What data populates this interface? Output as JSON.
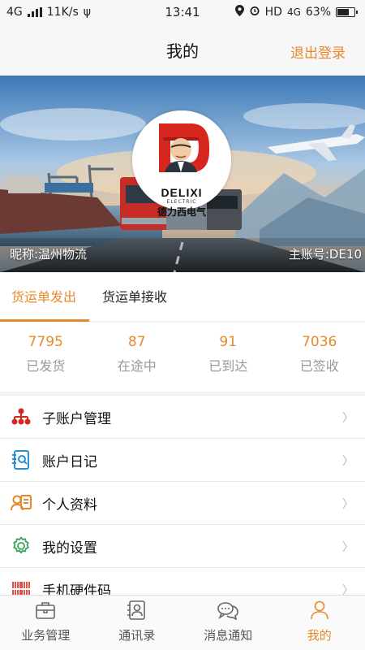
{
  "status_bar": {
    "network": "4G",
    "speed": "11K/s",
    "time": "13:41",
    "hd": "HD",
    "network2": "4G",
    "battery": "63%"
  },
  "header": {
    "title": "我的",
    "logout_label": "退出登录"
  },
  "banner": {
    "nickname": "昵称:温州物流",
    "account": "主账号:DE10",
    "logo_brand": "DELIXI",
    "logo_sub": "ELECTRIC",
    "logo_cn": "德力西电气"
  },
  "tabs": [
    {
      "label": "货运单发出",
      "active": true
    },
    {
      "label": "货运单接收",
      "active": false
    }
  ],
  "stats": [
    {
      "value": "7795",
      "label": "已发货"
    },
    {
      "value": "87",
      "label": "在途中"
    },
    {
      "value": "91",
      "label": "已到达"
    },
    {
      "value": "7036",
      "label": "已签收"
    }
  ],
  "menu": [
    {
      "label": "子账户管理",
      "icon": "org-chart-icon"
    },
    {
      "label": "账户日记",
      "icon": "journal-search-icon"
    },
    {
      "label": "个人资料",
      "icon": "profile-card-icon"
    },
    {
      "label": "我的设置",
      "icon": "gear-icon"
    },
    {
      "label": "手机硬件码",
      "icon": "barcode-icon"
    }
  ],
  "bottom_nav": [
    {
      "label": "业务管理",
      "icon": "briefcase-icon",
      "active": false
    },
    {
      "label": "通讯录",
      "icon": "contacts-icon",
      "active": false
    },
    {
      "label": "消息通知",
      "icon": "chat-bubbles-icon",
      "active": false
    },
    {
      "label": "我的",
      "icon": "person-icon",
      "active": true
    }
  ],
  "colors": {
    "accent": "#e6892a",
    "icon_red": "#d7261e",
    "icon_blue": "#2a8fd0",
    "icon_orange": "#e6892a",
    "icon_green": "#3aa45a"
  }
}
